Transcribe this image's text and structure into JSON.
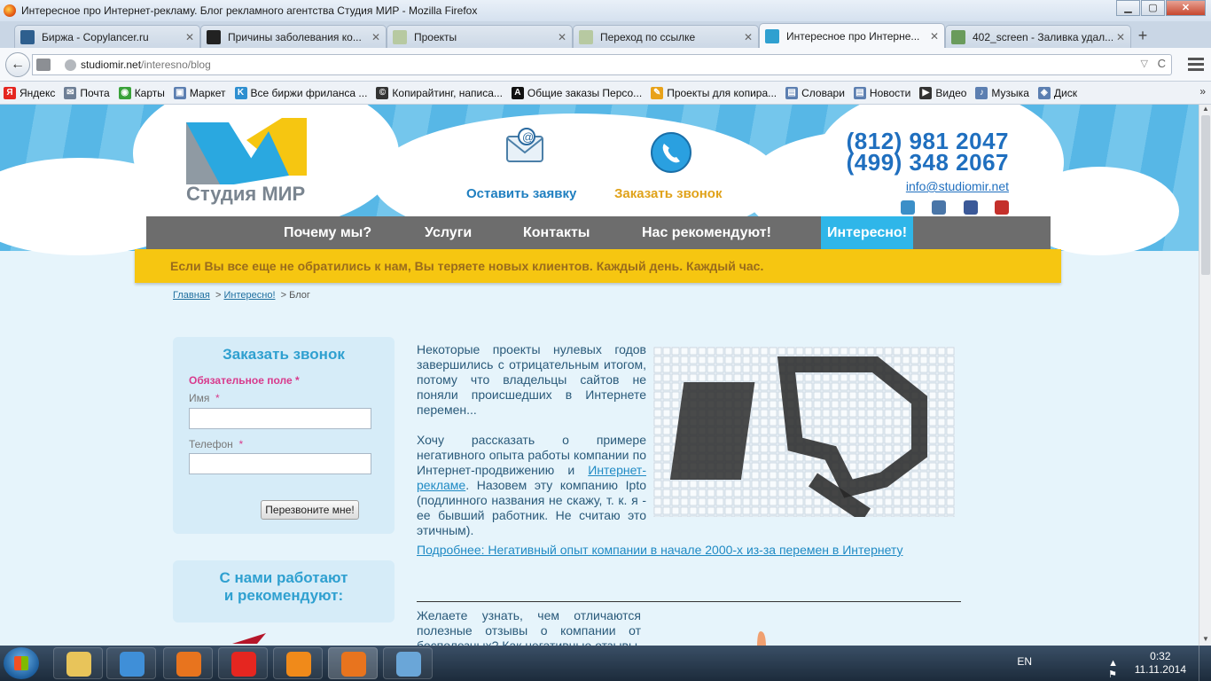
{
  "window": {
    "title": "Интересное про Интернет-рекламу. Блог рекламного агентства Студия МИР - Mozilla Firefox",
    "minimize": "▁",
    "maximize": "▢",
    "close": "✕"
  },
  "tabs": [
    {
      "label": "Биржа - Copylancer.ru",
      "icon": "copylancer-icon",
      "color": "#2e5f8e"
    },
    {
      "label": "Причины заболевания ко...",
      "icon": "site-favicon",
      "color": "#222"
    },
    {
      "label": "Проекты",
      "icon": "puzzle-favicon",
      "color": "#b7c9a1"
    },
    {
      "label": "Переход по ссылке",
      "icon": "puzzle-favicon",
      "color": "#b7c9a1"
    },
    {
      "label": "Интересное про Интерне...",
      "icon": "studiomir-favicon",
      "color": "#2fa0d0"
    },
    {
      "label": "402_screen - Заливка удал...",
      "icon": "image-favicon",
      "color": "#6a9b5c"
    }
  ],
  "tab_close": "✕",
  "new_tab": "+",
  "nav": {
    "back": "←",
    "url_host": "studiomir.net",
    "url_path": "/interesno/blog",
    "dropdown": "▽",
    "reload": "C"
  },
  "bookmarks": [
    {
      "label": "Яндекс",
      "icon": "yandex-icon",
      "color": "#e52620",
      "glyph": "Я"
    },
    {
      "label": "Почта",
      "icon": "mail-icon",
      "color": "#6e7f96",
      "glyph": "✉"
    },
    {
      "label": "Карты",
      "icon": "map-icon",
      "color": "#3aa23a",
      "glyph": "◉"
    },
    {
      "label": "Маркет",
      "icon": "market-icon",
      "color": "#5c7fb1",
      "glyph": "▣"
    },
    {
      "label": "Все биржи фриланса ...",
      "icon": "freelance-icon",
      "color": "#2e8fd0",
      "glyph": "K"
    },
    {
      "label": "Копирайтинг, написа...",
      "icon": "copyright-icon",
      "color": "#333",
      "glyph": "©"
    },
    {
      "label": "Общие заказы Персо...",
      "icon": "advego-icon",
      "color": "#111",
      "glyph": "A"
    },
    {
      "label": "Проекты для копира...",
      "icon": "pencil-icon",
      "color": "#e8a21a",
      "glyph": "✎"
    },
    {
      "label": "Словари",
      "icon": "dictionary-icon",
      "color": "#5c7fb1",
      "glyph": "▤"
    },
    {
      "label": "Новости",
      "icon": "news-icon",
      "color": "#5c7fb1",
      "glyph": "▤"
    },
    {
      "label": "Видео",
      "icon": "video-icon",
      "color": "#333",
      "glyph": "▶"
    },
    {
      "label": "Музыка",
      "icon": "music-icon",
      "color": "#5c7fb1",
      "glyph": "♪"
    },
    {
      "label": "Диск",
      "icon": "disk-icon",
      "color": "#5c7fb1",
      "glyph": "◈"
    }
  ],
  "bookmarks_more": "»",
  "site": {
    "logo_text": "Студия МИР",
    "request_label": "Оставить заявку",
    "call_label": "Заказать звонок",
    "phone1": "(812) 981 2047",
    "phone2": "(499) 348 2067",
    "email": "info@studiomir.net",
    "social": [
      "camera-social-icon",
      "vk-social-icon",
      "facebook-social-icon",
      "youtube-social-icon"
    ],
    "menu": [
      "Почему мы?",
      "Услуги",
      "Контакты",
      "Нас рекомендуют!",
      "Интересно!"
    ],
    "banner": "Если Вы все еще не обратились к нам, Вы теряете новых клиентов. Каждый день. Каждый час.",
    "breadcrumb": {
      "home": "Главная",
      "sep1": ">",
      "interesting": "Интересно!",
      "sep2": "> Блог"
    },
    "callback_form": {
      "title": "Заказать звонок",
      "required_note": "Обязательное поле *",
      "name_label": "Имя",
      "phone_label": "Телефон",
      "required_star": "*",
      "submit": "Перезвоните мне!"
    },
    "partners_title_1": "С нами работают",
    "partners_title_2": "и рекомендуют:",
    "article": {
      "para1": "Некоторые проекты нулевых годов завершились с отрицательным итогом, потому что владельцы сайтов не поняли происшедших в Интернете перемен...",
      "para2_start": "Хочу рассказать о примере негативного опыта работы компании по Интернет-продвижению и ",
      "para2_link": "Интернет-рекламе",
      "para2_end": ". Назовем эту компанию Ipto (подлинного названия не скажу, т. к. я - ее бывший работник. Не считаю это этичным).",
      "more_link": "Подробнее: Негативный опыт компании в начале 2000-х из-за перемен в Интернету"
    },
    "article2": "Желаете узнать, чем отличаются полезные отзывы о компании от бесполезных? Как негативные отзывы"
  },
  "taskbar": {
    "items": [
      {
        "icon": "explorer-icon",
        "color": "#e8c45a"
      },
      {
        "icon": "media-player-icon",
        "color": "#3f8fd8"
      },
      {
        "icon": "firefox-icon",
        "color": "#e8741e"
      },
      {
        "icon": "yandex-browser-icon",
        "color": "#e52620"
      },
      {
        "icon": "avast-icon",
        "color": "#f08a1a"
      },
      {
        "icon": "firefox-icon",
        "color": "#e8741e"
      },
      {
        "icon": "paint-icon",
        "color": "#6aa6d8"
      }
    ],
    "lang": "EN",
    "tray_icons": "▲ ⚑ ▣ ◄",
    "time": "0:32",
    "date": "11.11.2014"
  }
}
